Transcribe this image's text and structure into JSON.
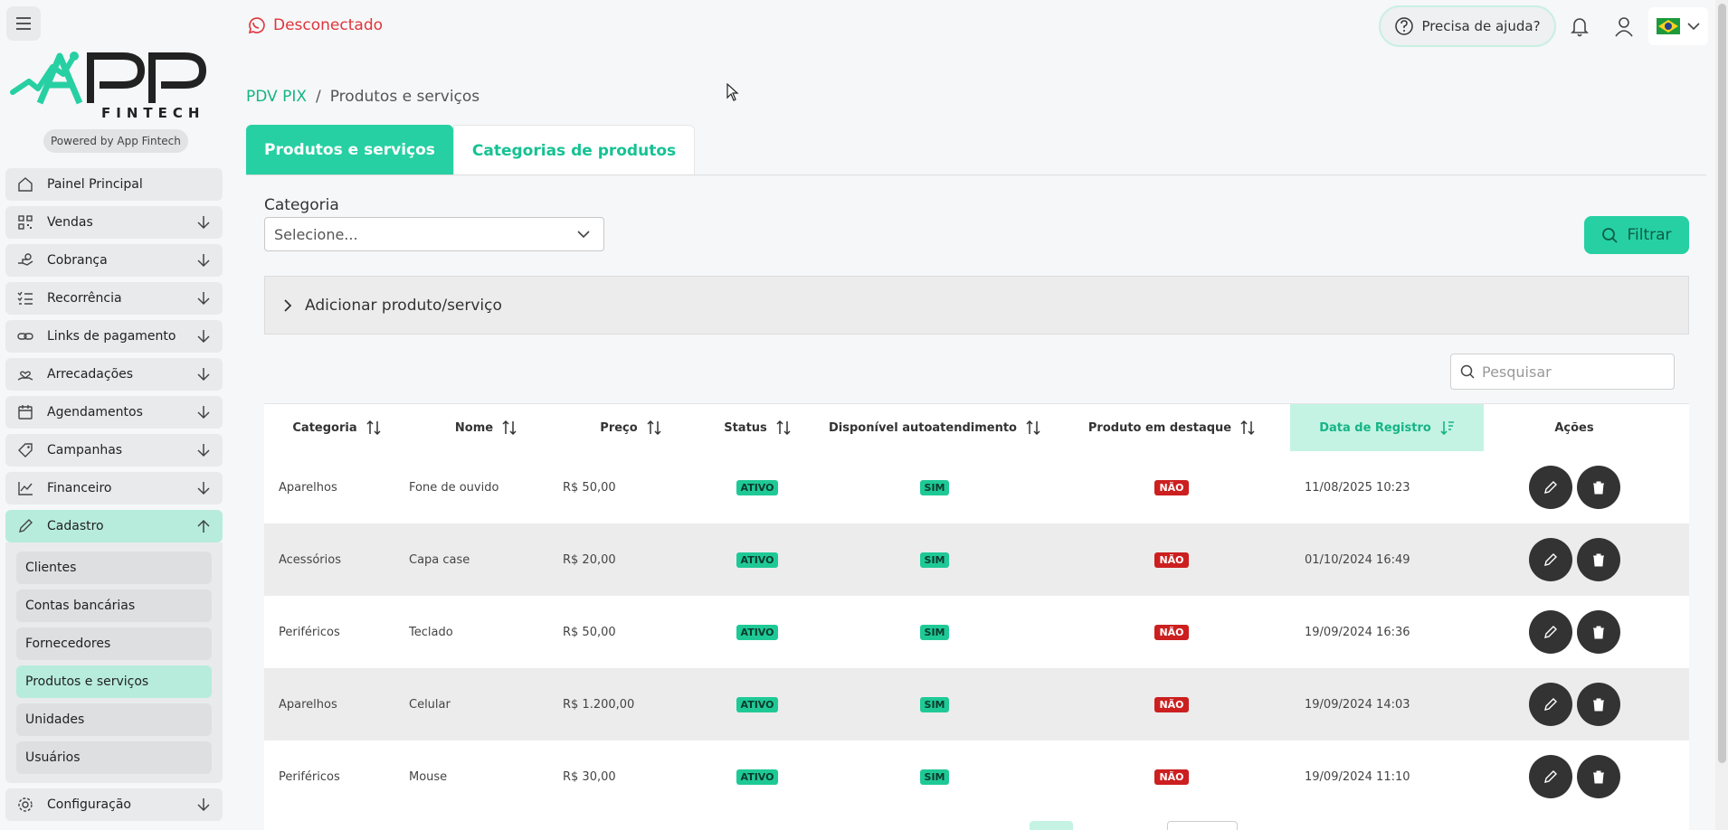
{
  "brand": {
    "logo_text": "APP",
    "logo_sub": "FINTECH",
    "powered_by": "Powered by App Fintech"
  },
  "header": {
    "status": "Desconectado",
    "help": "Precisa de ajuda?",
    "language_flag": "brazil-flag"
  },
  "sidebar": {
    "items": [
      {
        "label": "Painel Principal",
        "icon": "home-icon"
      },
      {
        "label": "Vendas",
        "icon": "qr-code-icon"
      },
      {
        "label": "Cobrança",
        "icon": "hand-coin-icon"
      },
      {
        "label": "Recorrência",
        "icon": "list-check-icon"
      },
      {
        "label": "Links de pagamento",
        "icon": "link-icon"
      },
      {
        "label": "Arrecadações",
        "icon": "donation-icon"
      },
      {
        "label": "Agendamentos",
        "icon": "calendar-icon"
      },
      {
        "label": "Campanhas",
        "icon": "tag-icon"
      },
      {
        "label": "Financeiro",
        "icon": "chart-line-icon"
      },
      {
        "label": "Cadastro",
        "icon": "pencil-icon"
      }
    ],
    "sub_items": [
      {
        "label": "Clientes"
      },
      {
        "label": "Contas bancárias"
      },
      {
        "label": "Fornecedores"
      },
      {
        "label": "Produtos e serviços"
      },
      {
        "label": "Unidades"
      },
      {
        "label": "Usuários"
      }
    ],
    "config": {
      "label": "Configuração",
      "icon": "gear-icon"
    }
  },
  "breadcrumb": {
    "parent": "PDV PIX",
    "separator": "/",
    "current": "Produtos e serviços"
  },
  "tabs": [
    {
      "label": "Produtos e serviços",
      "active": true
    },
    {
      "label": "Categorias de produtos",
      "active": false
    }
  ],
  "filter": {
    "category_label": "Categoria",
    "category_placeholder": "Selecione...",
    "button": "Filtrar"
  },
  "accordion": {
    "label": "Adicionar produto/serviço"
  },
  "search": {
    "placeholder": "Pesquisar"
  },
  "table": {
    "columns": [
      "Categoria",
      "Nome",
      "Preço",
      "Status",
      "Disponível autoatendimento",
      "Produto em destaque",
      "Data de Registro",
      "Ações"
    ],
    "rows": [
      {
        "categoria": "Aparelhos",
        "nome": "Fone de ouvido",
        "preco": "R$ 50,00",
        "status": "ATIVO",
        "auto": "SIM",
        "destaque": "NÃO",
        "data": "11/08/2025 10:23"
      },
      {
        "categoria": "Acessórios",
        "nome": "Capa case",
        "preco": "R$ 20,00",
        "status": "ATIVO",
        "auto": "SIM",
        "destaque": "NÃO",
        "data": "01/10/2024 16:49"
      },
      {
        "categoria": "Periféricos",
        "nome": "Teclado",
        "preco": "R$ 50,00",
        "status": "ATIVO",
        "auto": "SIM",
        "destaque": "NÃO",
        "data": "19/09/2024 16:36"
      },
      {
        "categoria": "Aparelhos",
        "nome": "Celular",
        "preco": "R$ 1.200,00",
        "status": "ATIVO",
        "auto": "SIM",
        "destaque": "NÃO",
        "data": "19/09/2024 14:03"
      },
      {
        "categoria": "Periféricos",
        "nome": "Mouse",
        "preco": "R$ 30,00",
        "status": "ATIVO",
        "auto": "SIM",
        "destaque": "NÃO",
        "data": "19/09/2024 11:10"
      }
    ]
  },
  "colors": {
    "accent": "#26d0a3",
    "accent_text": "#15b486",
    "danger": "#cc1f1f",
    "disconnected": "#e0353b"
  }
}
